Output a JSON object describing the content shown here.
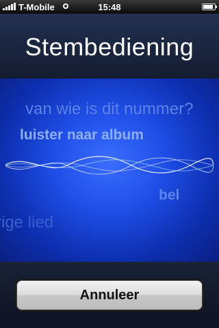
{
  "status_bar": {
    "carrier": "T-Mobile",
    "time": "15:48",
    "signal_bars": 5,
    "battery_level": 0.85
  },
  "header": {
    "title": "Stembediening"
  },
  "voice_area": {
    "phrases": [
      "van wie is dit nummer?",
      "luister naar album",
      "bel",
      "rige lied"
    ],
    "accent_color": "#1f4fe8"
  },
  "footer": {
    "cancel_label": "Annuleer"
  }
}
